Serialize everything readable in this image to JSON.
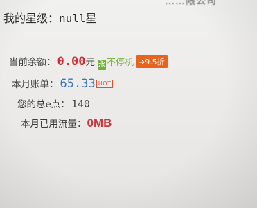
{
  "header": {
    "company_text": "……限公司"
  },
  "account": {
    "star_label": "我的星级：",
    "star_value": "null星",
    "balance_label": "当前余额：",
    "balance_value": "0.00",
    "balance_unit": "元",
    "no_stop_icon": "永",
    "no_stop_text": "不停机",
    "discount_badge": "9.5折",
    "bill_label": "本月账单：",
    "bill_value": "65.33",
    "hot_badge": "HOT",
    "points_label": "您的总e点：",
    "points_value": "140",
    "flow_label": "本月已用流量：",
    "flow_value": "0MB"
  },
  "colors": {
    "amount_red": "#cc3036",
    "amount_blue": "#3a73b8",
    "badge_orange": "#e8641e",
    "icon_green": "#6fb23a"
  }
}
